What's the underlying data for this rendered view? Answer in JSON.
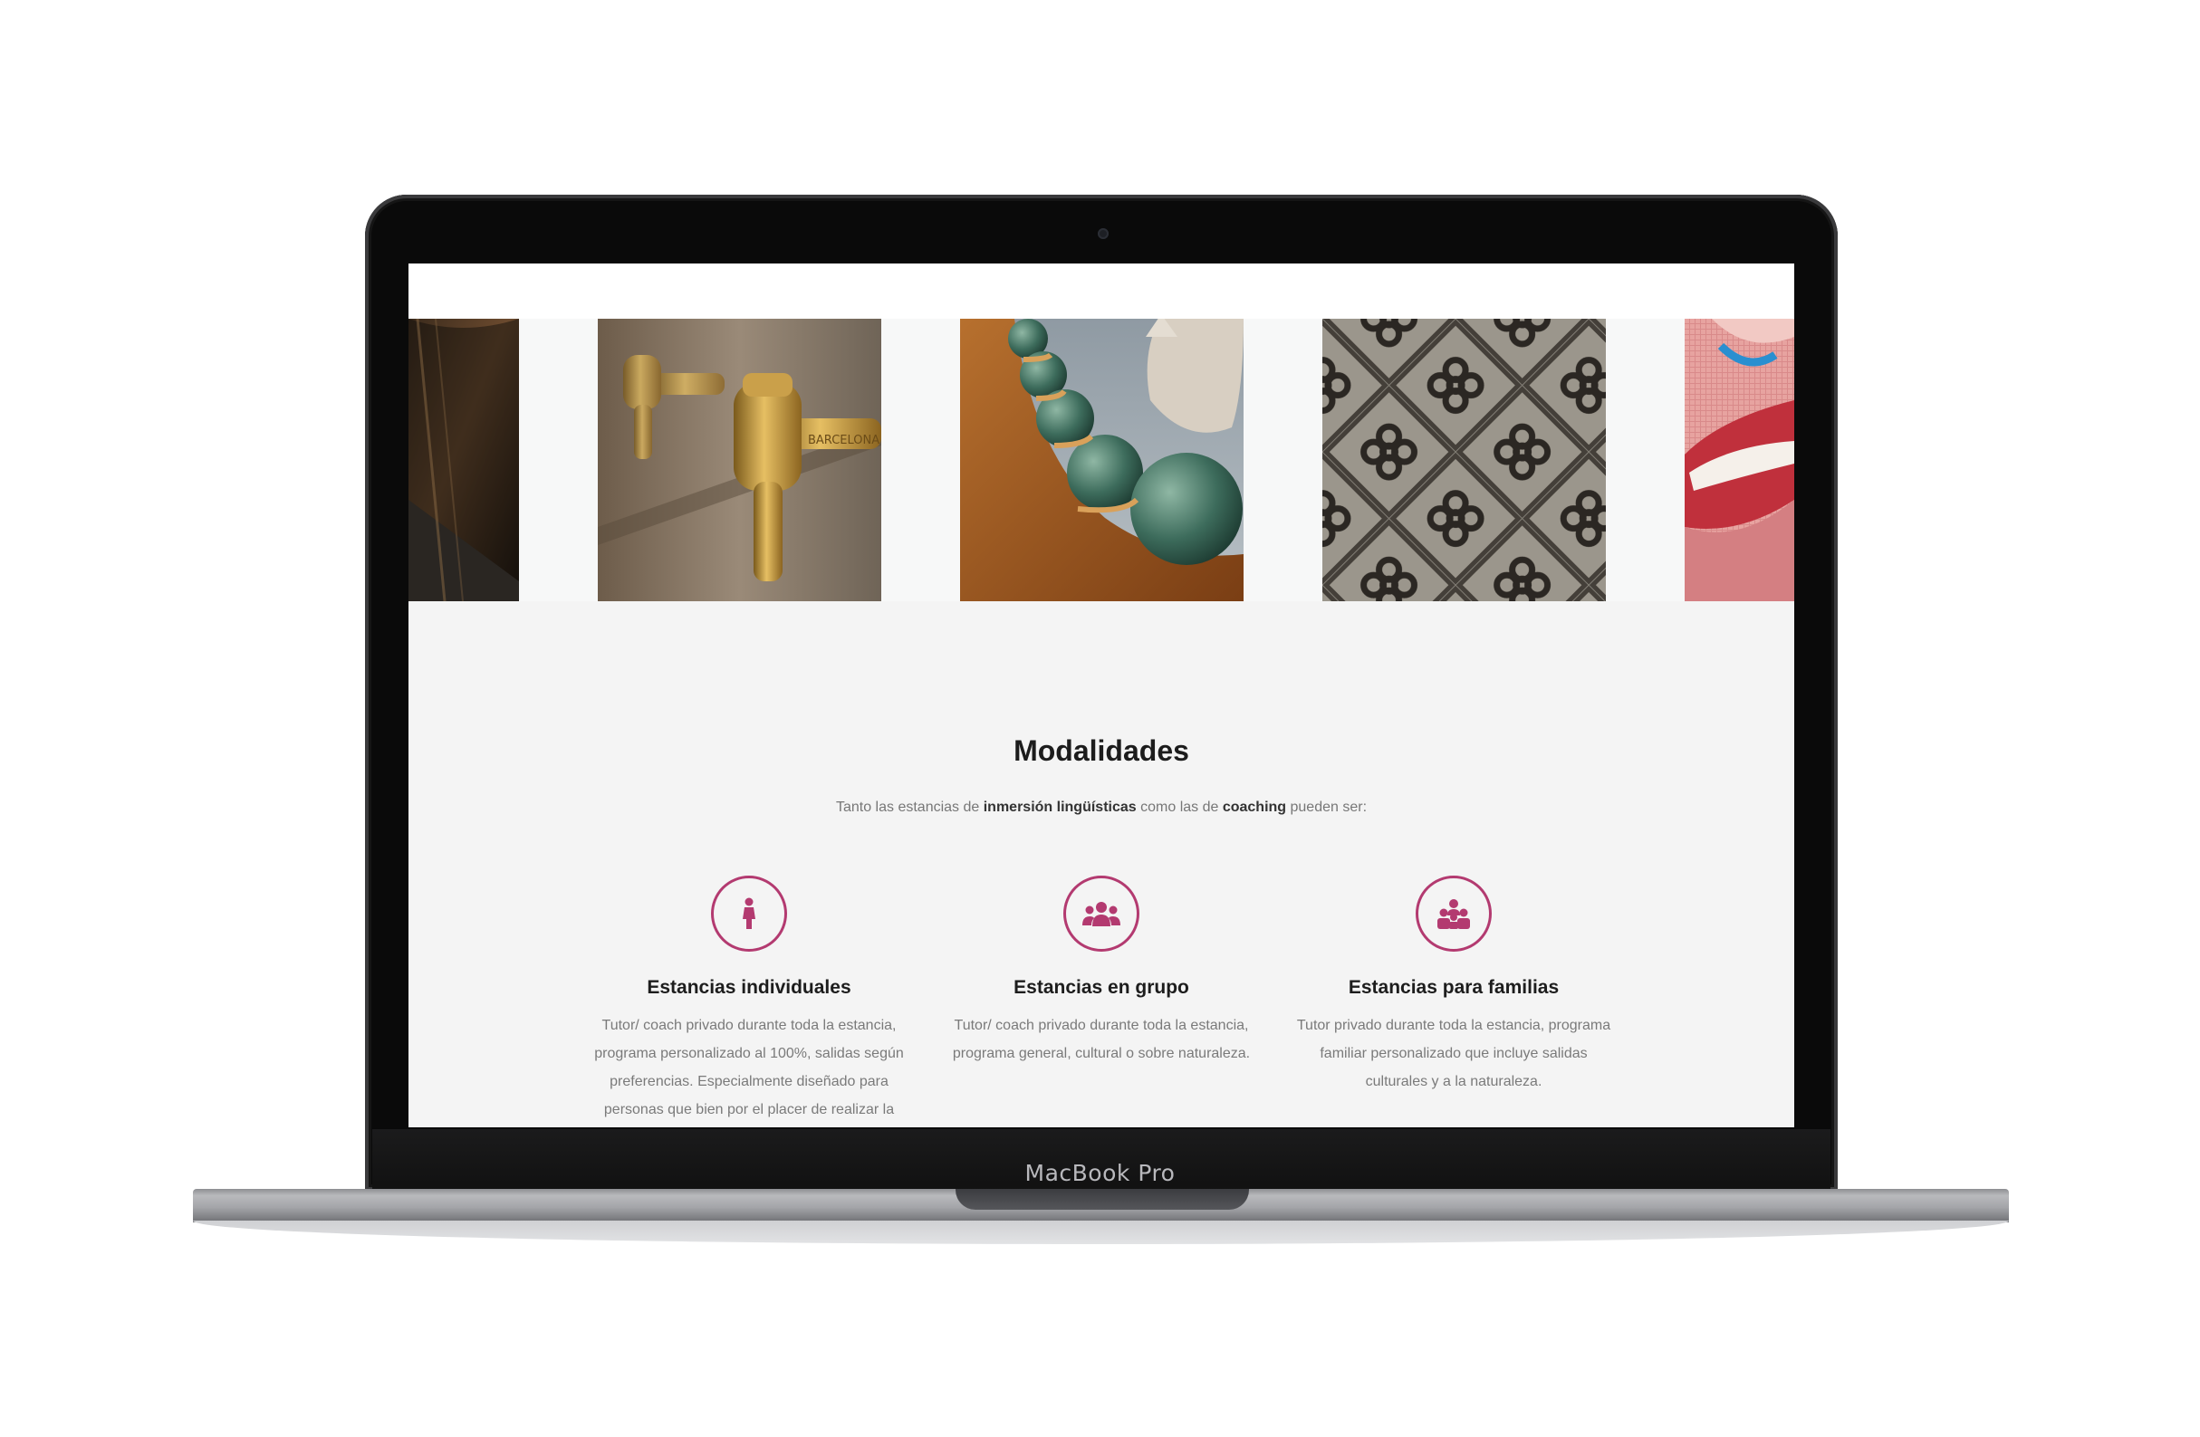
{
  "device": {
    "model_label": "MacBook Pro"
  },
  "gallery": {
    "photos": [
      {
        "name": "dark-alley-photo",
        "subject": "dark narrow alley"
      },
      {
        "name": "brass-taps-photo",
        "subject": "brass water fountain taps",
        "engraving": "BARCELONA"
      },
      {
        "name": "gaudi-roof-photo",
        "subject": "ceramic tiled roof spheres"
      },
      {
        "name": "flower-tiles-photo",
        "subject": "pavement flower tiles"
      },
      {
        "name": "mosaic-lips-photo",
        "subject": "mosaic of lips"
      }
    ]
  },
  "section": {
    "title": "Modalidades",
    "intro_prefix": "Tanto las estancias de ",
    "intro_bold_1": "inmersión lingüísticas",
    "intro_middle": " como las de ",
    "intro_bold_2": "coaching",
    "intro_suffix": " pueden ser:"
  },
  "modalities": [
    {
      "icon": "person-icon",
      "title": "Estancias individuales",
      "lines": [
        "Tutor/ coach privado durante toda la estancia,",
        "programa personalizado al 100%, salidas según",
        "preferencias. Especialmente diseñado para",
        "personas que bien por el placer de realizar la"
      ]
    },
    {
      "icon": "group-icon",
      "title": "Estancias en grupo",
      "lines": [
        "Tutor/ coach privado durante toda la estancia,",
        "programa general, cultural o sobre naturaleza."
      ]
    },
    {
      "icon": "family-icon",
      "title": "Estancias para familias",
      "lines": [
        "Tutor privado durante toda la estancia, programa",
        "familiar personalizado que incluye salidas",
        "culturales y a la naturaleza."
      ]
    }
  ],
  "colors": {
    "accent": "#b33a70",
    "heading": "#1c1c1c",
    "body_text": "#7a7a7a",
    "section_bg": "#f4f4f4"
  }
}
